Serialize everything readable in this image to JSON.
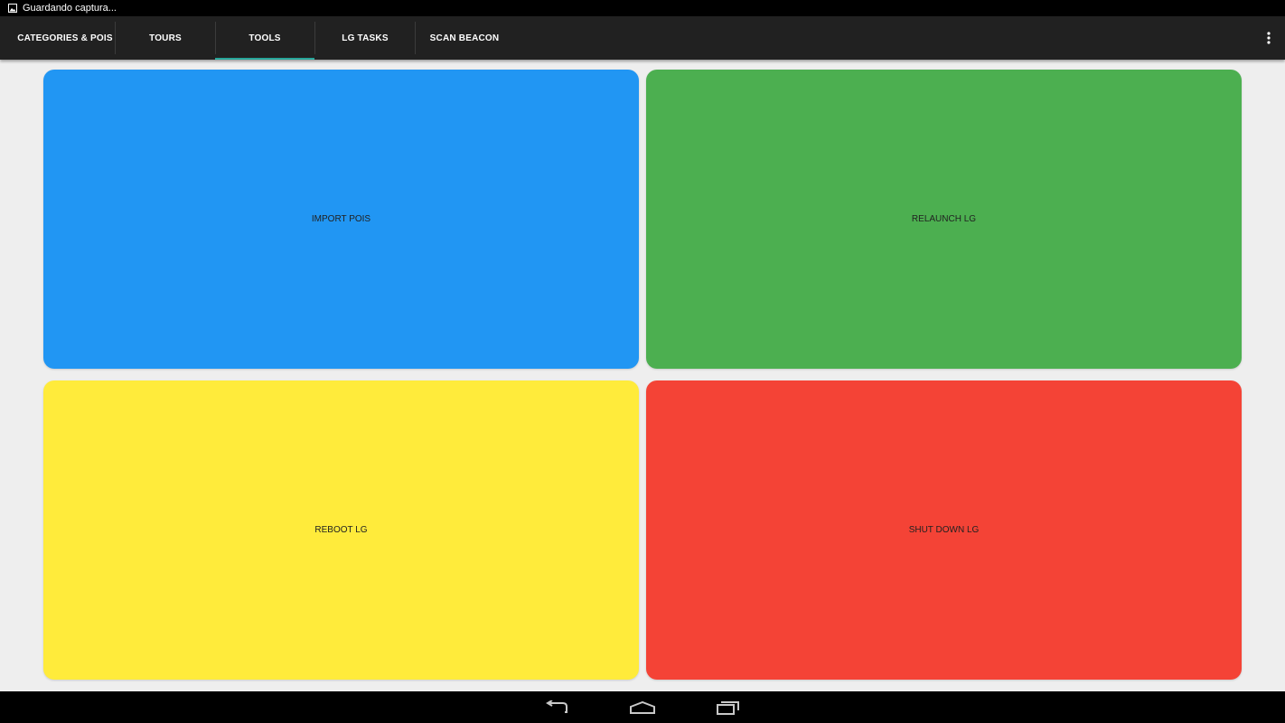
{
  "status_bar": {
    "notification_icon": "picture-icon",
    "text": "Guardando captura..."
  },
  "tabs": [
    {
      "label": "CATEGORIES & POIS",
      "active": false
    },
    {
      "label": "TOURS",
      "active": false
    },
    {
      "label": "TOOLS",
      "active": true
    },
    {
      "label": "LG TASKS",
      "active": false
    },
    {
      "label": "SCAN BEACON",
      "active": false
    }
  ],
  "overflow_menu_icon": "more-vert-icon",
  "tools": [
    {
      "label": "IMPORT POIS",
      "color": "#2196f3"
    },
    {
      "label": "RELAUNCH LG",
      "color": "#4caf50"
    },
    {
      "label": "REBOOT LG",
      "color": "#ffeb3b"
    },
    {
      "label": "SHUT DOWN LG",
      "color": "#f44336"
    }
  ],
  "colors": {
    "tab_bar": "#212121",
    "tab_indicator": "#26a69a",
    "background": "#eeeeee"
  },
  "nav_bar": {
    "back_icon": "back-icon",
    "home_icon": "home-icon",
    "recents_icon": "recents-icon"
  }
}
